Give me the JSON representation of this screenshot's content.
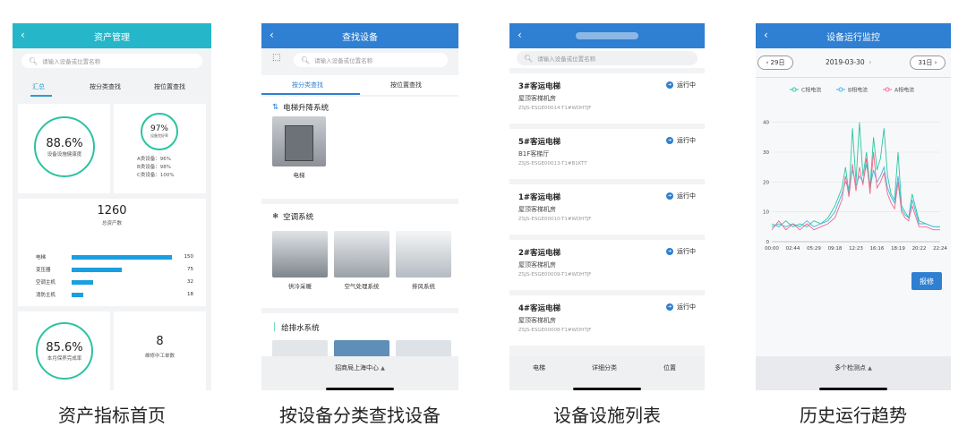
{
  "panel1": {
    "title": "资产管理",
    "search_placeholder": "请输入设备或位置名称",
    "tabs": [
      "汇总",
      "按分类查找",
      "按位置查找"
    ],
    "health_rate": {
      "value": "88.6%",
      "label": "设备设施健康度"
    },
    "intact_rate": {
      "value": "97%",
      "label": "设备完好率",
      "lines": [
        "A类设备：96%",
        "B类设备：98%",
        "C类设备：100%"
      ]
    },
    "total_assets": {
      "value": "1260",
      "label": "总资产数"
    },
    "asset_bars": [
      {
        "name": "电梯",
        "value": 150
      },
      {
        "name": "变压器",
        "value": 75
      },
      {
        "name": "空调主机",
        "value": 32
      },
      {
        "name": "消防主机",
        "value": 18
      }
    ],
    "maintenance_rate": {
      "value": "85.6%",
      "label": "本月保养完成率"
    },
    "orders": {
      "value": "8",
      "label": "维修中工单数"
    },
    "caption": "资产指标首页"
  },
  "panel2": {
    "title": "查找设备",
    "search_placeholder": "请输入设备或位置名称",
    "tabs": [
      "按分类查找",
      "按位置查找"
    ],
    "sections": [
      {
        "title": "电梯升降系统",
        "items": [
          "电梯"
        ]
      },
      {
        "title": "空调系统",
        "items": [
          "供冷采暖",
          "空气处理系统",
          "排风系统"
        ]
      },
      {
        "title": "给排水系统",
        "items": []
      }
    ],
    "bottom_label": "招商局上海中心",
    "caption": "按设备分类查找设备"
  },
  "panel3": {
    "search_placeholder": "请输入设备或位置名称",
    "items": [
      {
        "title": "3#客运电梯",
        "location": "屋顶客梯机房",
        "code": "ZSJS-ESGE00014-T1#WDHTJF",
        "status": "运行中"
      },
      {
        "title": "5#客运电梯",
        "location": "B1F客梯厅",
        "code": "ZSJS-ESGE00013-T1#B1KTT",
        "status": "运行中"
      },
      {
        "title": "1#客运电梯",
        "location": "屋顶客梯机房",
        "code": "ZSJS-ESGE00010-T1#WDHTJF",
        "status": "运行中"
      },
      {
        "title": "2#客运电梯",
        "location": "屋顶客梯机房",
        "code": "ZSJS-ESGE00009-T1#WDHTJF",
        "status": "运行中"
      },
      {
        "title": "4#客运电梯",
        "location": "屋顶客梯机房",
        "code": "ZSJS-ESGE00008-T1#WDHTJF",
        "status": "运行中"
      }
    ],
    "bottom_tabs": [
      "电梯",
      "详细分类",
      "位置"
    ],
    "caption": "设备设施列表"
  },
  "panel4": {
    "title": "设备运行监控",
    "prev_day": "29日",
    "date": "2019-03-30",
    "next_day": "31日",
    "repair_button": "报修",
    "bottom_label": "多个检测点",
    "caption": "历史运行趋势",
    "chart_data": {
      "type": "line",
      "legend": [
        "C相电流",
        "B相电流",
        "A相电流"
      ],
      "colors": [
        "#2ec7a0",
        "#44b4e8",
        "#ef6a8a"
      ],
      "x_ticks": [
        "00:00",
        "02:44",
        "05:29",
        "09:18",
        "12:23",
        "16:16",
        "18:19",
        "20:22",
        "22:24"
      ],
      "y_ticks": [
        0,
        10,
        20,
        30,
        40
      ],
      "ylim": [
        0,
        45
      ],
      "x_hours": [
        0,
        1,
        2,
        3,
        4,
        5,
        6,
        7,
        8,
        9,
        10,
        10.5,
        11,
        11.5,
        12,
        12.5,
        13,
        13.5,
        14,
        14.5,
        15,
        15.5,
        16,
        16.5,
        17,
        17.5,
        18,
        18.5,
        19,
        19.5,
        20,
        21,
        22,
        23,
        24
      ],
      "series": [
        {
          "name": "C相电流",
          "values": [
            6,
            5,
            7,
            5,
            6,
            5,
            7,
            6,
            8,
            12,
            18,
            25,
            16,
            38,
            20,
            40,
            22,
            30,
            18,
            35,
            24,
            28,
            38,
            22,
            16,
            14,
            30,
            12,
            10,
            8,
            16,
            7,
            6,
            5,
            5
          ]
        },
        {
          "name": "B相电流",
          "values": [
            5,
            6,
            5,
            6,
            5,
            7,
            5,
            6,
            7,
            10,
            16,
            20,
            18,
            24,
            19,
            22,
            20,
            26,
            18,
            24,
            20,
            22,
            25,
            18,
            15,
            13,
            22,
            11,
            9,
            8,
            14,
            6,
            6,
            5,
            5
          ]
        },
        {
          "name": "A相电流",
          "values": [
            4,
            7,
            4,
            6,
            4,
            6,
            4,
            5,
            6,
            8,
            14,
            22,
            15,
            26,
            17,
            25,
            19,
            28,
            16,
            30,
            18,
            20,
            23,
            16,
            13,
            11,
            20,
            10,
            8,
            7,
            12,
            5,
            5,
            4,
            4
          ]
        }
      ]
    }
  }
}
